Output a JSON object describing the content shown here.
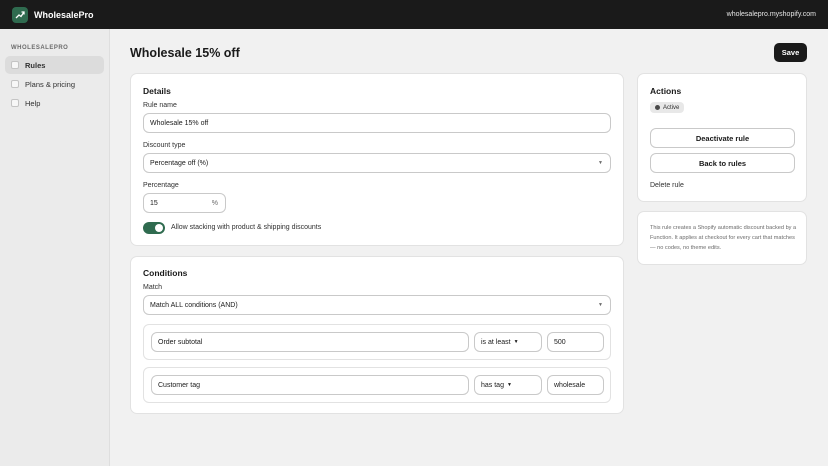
{
  "app": {
    "name": "WholesalePro",
    "shop_domain": "wholesalepro.myshopify.com"
  },
  "sidebar": {
    "heading": "WHOLESALEPRO",
    "items": [
      {
        "label": "Rules",
        "active": true
      },
      {
        "label": "Plans & pricing",
        "active": false
      },
      {
        "label": "Help",
        "active": false
      }
    ]
  },
  "page": {
    "title": "Wholesale 15% off",
    "save_label": "Save"
  },
  "details": {
    "title": "Details",
    "rule_name_label": "Rule name",
    "rule_name_value": "Wholesale 15% off",
    "discount_type_label": "Discount type",
    "discount_type_value": "Percentage off (%)",
    "percentage_label": "Percentage",
    "percentage_value": "15",
    "percentage_suffix": "%",
    "stacking_label": "Allow stacking with product & shipping discounts",
    "stacking_enabled": true
  },
  "conditions": {
    "title": "Conditions",
    "match_label": "Match",
    "match_value": "Match ALL conditions (AND)",
    "rows": [
      {
        "field": "Order subtotal",
        "operator": "is at least",
        "value": "500"
      },
      {
        "field": "Customer tag",
        "operator": "has tag",
        "value": "wholesale"
      }
    ]
  },
  "actions": {
    "title": "Actions",
    "status": "Active",
    "deactivate_label": "Deactivate rule",
    "back_label": "Back to rules",
    "delete_label": "Delete rule"
  },
  "info": {
    "text": "This rule creates a Shopify automatic discount backed by a Function. It applies at checkout for every cart that matches — no codes, no theme edits."
  },
  "colors": {
    "topbar": "#1a1a1a",
    "accent": "#2f6b4f"
  }
}
